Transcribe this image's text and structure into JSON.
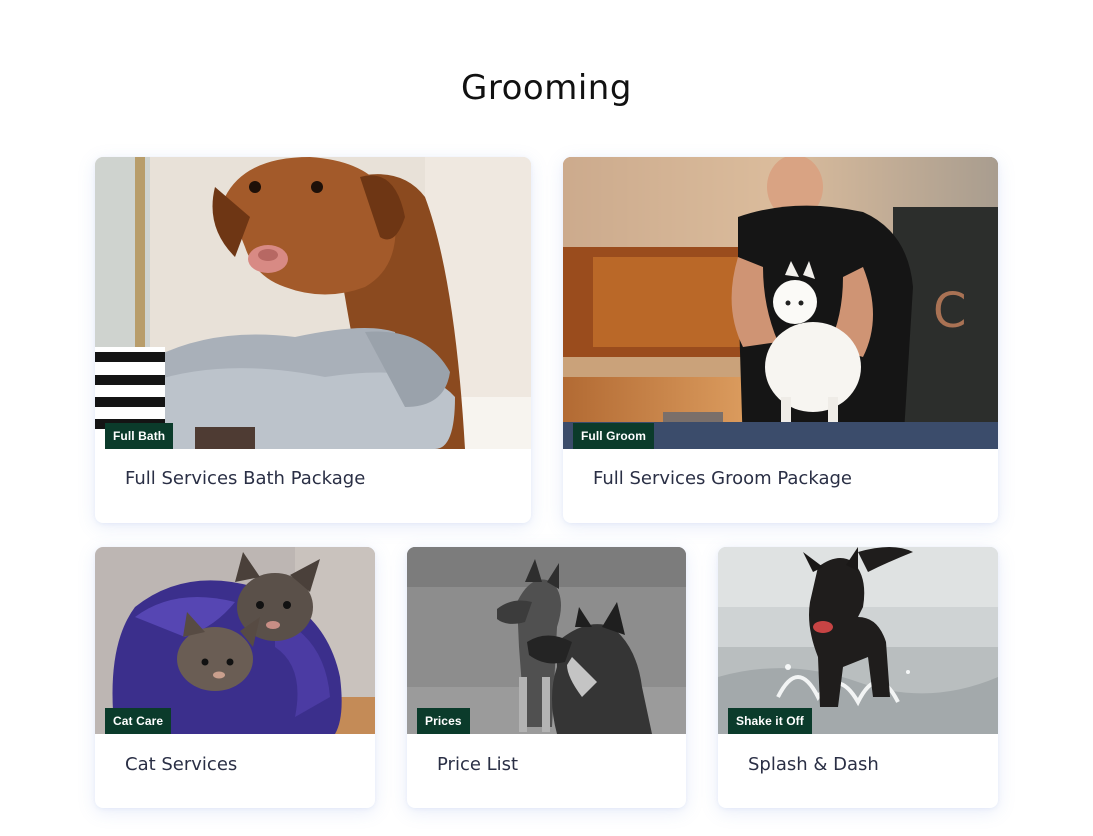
{
  "section": {
    "title": "Grooming"
  },
  "cards": [
    {
      "badge": "Full Bath",
      "title": "Full Services Bath Package"
    },
    {
      "badge": "Full Groom",
      "title": "Full Services Groom Package"
    },
    {
      "badge": "Cat Care",
      "title": "Cat Services"
    },
    {
      "badge": "Prices",
      "title": "Price List"
    },
    {
      "badge": "Shake it Off",
      "title": "Splash & Dash"
    }
  ],
  "theme": {
    "badge_bg": "#0b3b2b",
    "title_color": "#2a2f45",
    "card_shadow": "#6e8cdc"
  }
}
